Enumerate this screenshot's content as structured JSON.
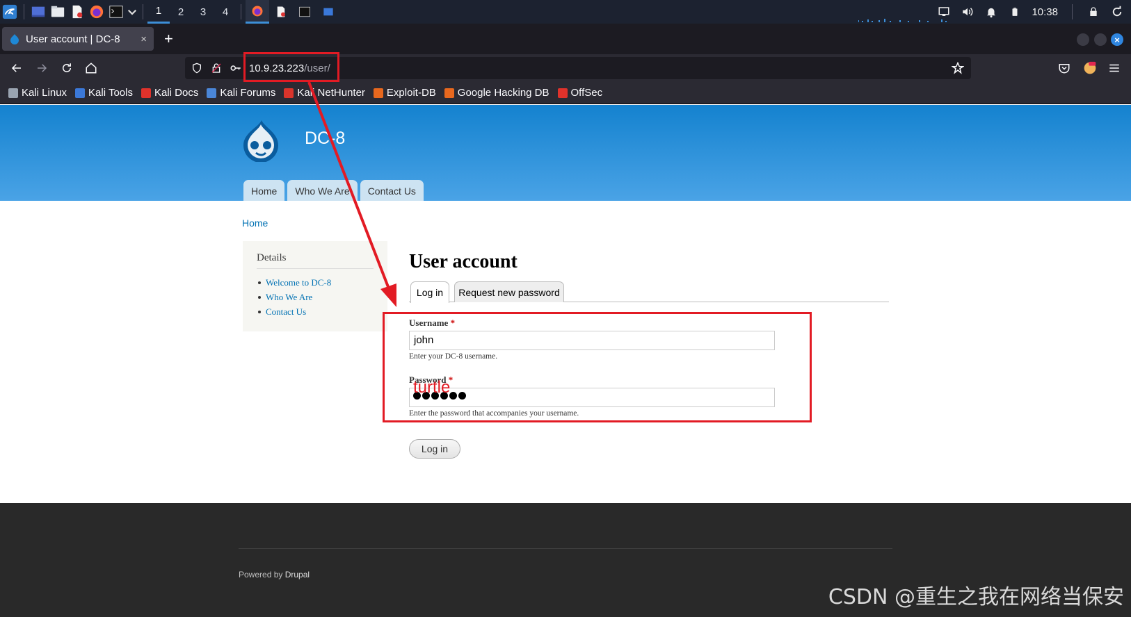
{
  "taskbar": {
    "workspaces": [
      "1",
      "2",
      "3",
      "4"
    ],
    "time": "10:38"
  },
  "browser": {
    "tab_title": "User account | DC-8",
    "tab_close": "×",
    "new_tab": "+",
    "url_host": "10.9.23.223",
    "url_path": "/user/"
  },
  "bookmarks": [
    {
      "label": "Kali Linux",
      "color": "#9aa4b1"
    },
    {
      "label": "Kali Tools",
      "color": "#3b78d8"
    },
    {
      "label": "Kali Docs",
      "color": "#e0322b"
    },
    {
      "label": "Kali Forums",
      "color": "#4a86d8"
    },
    {
      "label": "Kali NetHunter",
      "color": "#d9342b"
    },
    {
      "label": "Exploit-DB",
      "color": "#e8681e"
    },
    {
      "label": "Google Hacking DB",
      "color": "#e8681e"
    },
    {
      "label": "OffSec",
      "color": "#e0322b"
    }
  ],
  "site": {
    "name": "DC-8",
    "nav": [
      "Home",
      "Who We Are",
      "Contact Us"
    ],
    "breadcrumb": "Home",
    "sidebar_title": "Details",
    "sidebar_links": [
      "Welcome to DC-8",
      "Who We Are",
      "Contact Us"
    ],
    "page_title": "User account",
    "tabs": [
      "Log in",
      "Request new password"
    ],
    "username_label": "Username",
    "username_value": "john",
    "username_desc": "Enter your DC-8 username.",
    "password_label": "Password",
    "password_desc": "Enter the password that accompanies your username.",
    "required_mark": "*",
    "login_button": "Log in",
    "footer_prefix": "Powered by ",
    "footer_link": "Drupal"
  },
  "annotation": {
    "password_hint": "turtle",
    "color": "#e21b24"
  },
  "watermark": "CSDN @重生之我在网络当保安"
}
